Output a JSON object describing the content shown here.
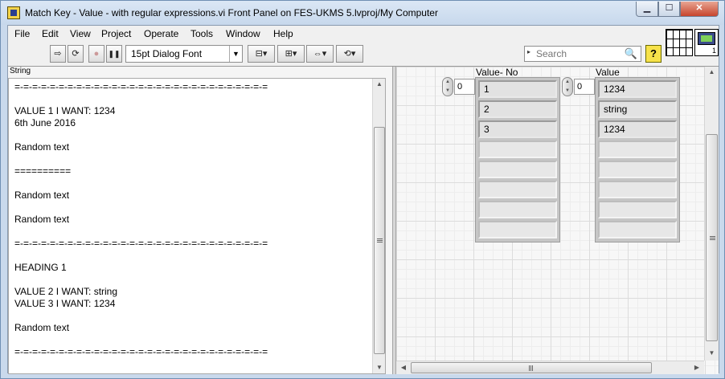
{
  "window": {
    "title": "Match Key - Value - with regular expressions.vi Front Panel on FES-UKMS 5.lvproj/My Computer",
    "min_label": "▁",
    "max_label": "☐",
    "close_label": "✕"
  },
  "menu": [
    "File",
    "Edit",
    "View",
    "Project",
    "Operate",
    "Tools",
    "Window",
    "Help"
  ],
  "toolbar": {
    "run_glyph": "⇨",
    "run_continuous_glyph": "⟳",
    "abort_glyph": "●",
    "pause_glyph": "❚❚",
    "font": "15pt Dialog Font",
    "font_arrow": "▼",
    "align_glyph": "⊟▾",
    "distribute_glyph": "⊞▾",
    "resize_glyph": "⇔▾",
    "reorder_glyph": "⟲▾",
    "search_placeholder": "Search",
    "search_caret": "▸",
    "search_icon": "🔍",
    "help_label": "?"
  },
  "connector": {
    "icon_number": "1"
  },
  "string_control": {
    "label": "String",
    "lines": [
      "=-=-=-=-=-=-=-=-=-=-=-=-=-=-=-=-=-=-=-=-=-=-=-=-=-=-=-=-=",
      "",
      "VALUE 1 I WANT: 1234",
      "6th June 2016",
      "",
      "Random text",
      "",
      "==========",
      "",
      "Random text",
      "",
      "Random text",
      "",
      "=-=-=-=-=-=-=-=-=-=-=-=-=-=-=-=-=-=-=-=-=-=-=-=-=-=-=-=-=",
      "",
      "HEADING 1",
      "",
      "VALUE 2 I WANT: string",
      "VALUE 3 I WANT: 1234",
      "",
      "Random text",
      "",
      "=-=-=-=-=-=-=-=-=-=-=-=-=-=-=-=-=-=-=-=-=-=-=-=-=-=-=-=-="
    ]
  },
  "arrays": [
    {
      "label": "Value- No",
      "index": "0",
      "values": [
        "1",
        "2",
        "3"
      ],
      "empty_cells": 5
    },
    {
      "label": "Value",
      "index": "0",
      "values": [
        "1234",
        "string",
        "1234"
      ],
      "empty_cells": 5
    }
  ],
  "scroll": {
    "up": "▲",
    "down": "▼",
    "left": "◀",
    "right": "▶"
  }
}
